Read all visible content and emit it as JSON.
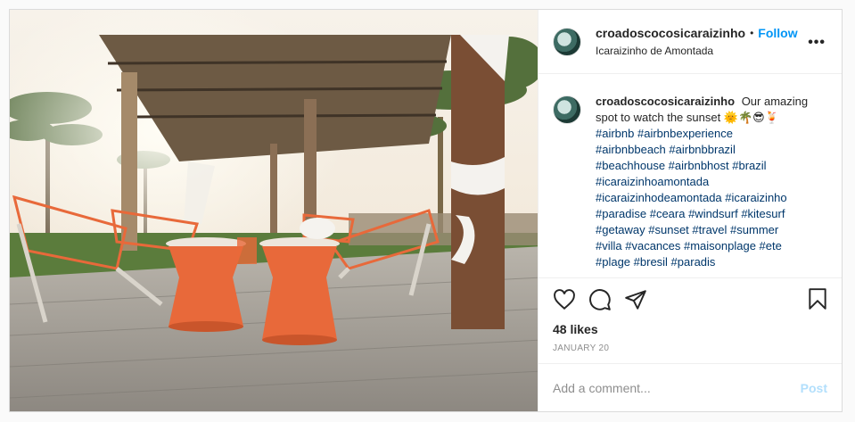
{
  "post": {
    "username": "croadoscocosicaraizinho",
    "separator": "•",
    "follow_label": "Follow",
    "location": "Icaraizinho de Amontada",
    "more_label": "•••",
    "caption_text": "Our amazing spot to watch the sunset 🌞🌴😎🍹",
    "hashtags": [
      "#airbnb #airbnbexperience",
      "#airbnbbeach #airbnbbrazil",
      "#beachhouse #airbnbhost #brazil",
      "#icaraizinhoamontada",
      "#icaraizinhodeamontada #icaraizinho",
      "#paradise #ceara #windsurf #kitesurf",
      "#getaway #sunset #travel #summer",
      "#villa #vacances #maisonplage #ete",
      "#plage #bresil #paradis"
    ],
    "likes": "48 likes",
    "date": "JANUARY 20",
    "comment_placeholder": "Add a comment...",
    "post_label": "Post"
  },
  "icons": {
    "like": "heart-icon",
    "comment": "comment-icon",
    "share": "share-icon",
    "save": "bookmark-icon",
    "more": "more-options-icon"
  },
  "colors": {
    "link_blue": "#0095f6",
    "hashtag": "#00376b",
    "post_disabled": "#b2dffc",
    "chair_orange": "#e8693a"
  }
}
